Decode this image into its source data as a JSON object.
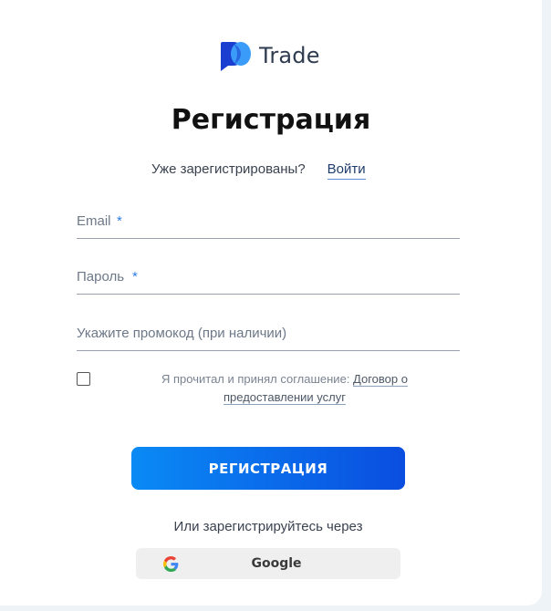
{
  "brand": {
    "name": "Trade",
    "logo_icon": "chat-bubble-logo-icon",
    "colors": {
      "dark": "#1a3fd0",
      "light": "#3a9cf8"
    }
  },
  "page": {
    "title": "Регистрация"
  },
  "login_prompt": {
    "text": "Уже зарегистрированы?",
    "link_label": "Войти"
  },
  "form": {
    "email": {
      "label": "Email",
      "required_mark": "*",
      "value": ""
    },
    "password": {
      "label": "Пароль",
      "required_mark": "*",
      "value": ""
    },
    "promo": {
      "placeholder": "Укажите промокод (при наличии)",
      "value": ""
    },
    "agreement": {
      "checked": false,
      "text": "Я прочитал и принял соглашение:",
      "link_part1": "Договор о",
      "link_part2": "предоставлении услуг"
    },
    "submit_label": "РЕГИСТРАЦИЯ"
  },
  "social": {
    "prompt": "Или зарегистрируйтесь через",
    "google": {
      "label": "Google",
      "icon": "google-icon"
    }
  },
  "colors": {
    "accent_start": "#0a8af5",
    "accent_end": "#0a4ee0",
    "required": "#2d7de0"
  }
}
